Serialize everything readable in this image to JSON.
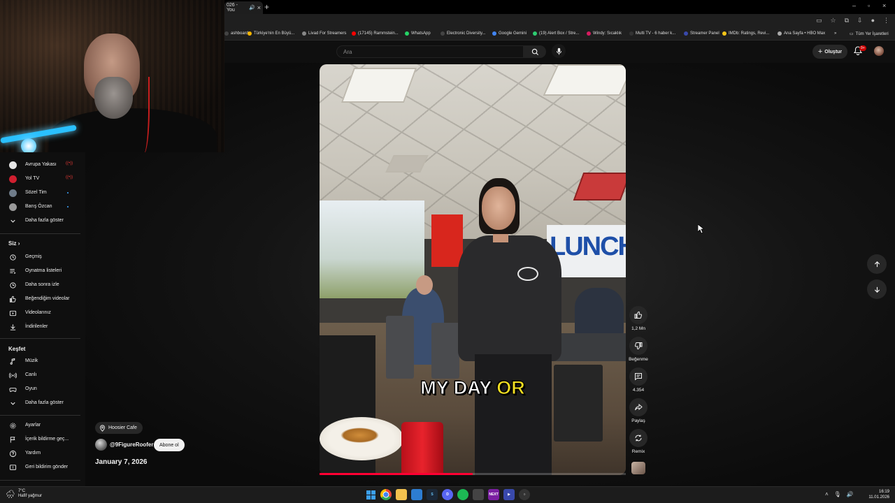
{
  "browser": {
    "tab_title": "026 - You",
    "bookmarks": [
      {
        "label": "ashboard",
        "color": "#444444"
      },
      {
        "label": "Türkiye'nin En Büyü...",
        "color": "#f4b400"
      },
      {
        "label": "Livad For Streamers",
        "color": "#888888"
      },
      {
        "label": "(17145) Rammstein...",
        "color": "#ff0000"
      },
      {
        "label": "WhatsApp",
        "color": "#25d366"
      },
      {
        "label": "Electronic Diversity...",
        "color": "#444444"
      },
      {
        "label": "Google Gemini",
        "color": "#4285f4"
      },
      {
        "label": "(19) Alert Box / Stre...",
        "color": "#2ecc71"
      },
      {
        "label": "Windy: Sıcaklık",
        "color": "#d81b60"
      },
      {
        "label": "Multi TV - 6 haber k...",
        "color": "#333333"
      },
      {
        "label": "Streamer Panel",
        "color": "#3949ab"
      },
      {
        "label": "IMDb: Ratings, Revi...",
        "color": "#f5c518"
      },
      {
        "label": "Ana Sayfa • HBO Max",
        "color": "#aaaaaa"
      }
    ],
    "more_bookmarks": "»",
    "all_bookmarks": "Tüm Yer İşaretleri"
  },
  "header": {
    "search_placeholder": "Ara",
    "create_label": "Oluştur",
    "notif_count": "9+"
  },
  "sidebar": {
    "subscriptions": [
      {
        "label": "Avrupa Yakası",
        "avatar_color": "#e6e6e6",
        "live": true
      },
      {
        "label": "Yol TV",
        "avatar_color": "#d01f2f",
        "live": true
      },
      {
        "label": "Sözel Tim",
        "avatar_color": "#6f7c8a",
        "live": false
      },
      {
        "label": "Barış Özcan",
        "avatar_color": "#9a9a9a",
        "live": false
      }
    ],
    "live_mark": "((•))",
    "show_more": "Daha fazla göster",
    "you_section": "Siz",
    "you_items": [
      {
        "icon": "history-icon",
        "label": "Geçmiş"
      },
      {
        "icon": "playlist-icon",
        "label": "Oynatma listeleri"
      },
      {
        "icon": "watch-later-icon",
        "label": "Daha sonra izle"
      },
      {
        "icon": "like-icon",
        "label": "Beğendiğim videolar"
      },
      {
        "icon": "your-videos-icon",
        "label": "Videolarınız"
      },
      {
        "icon": "download-icon",
        "label": "İndirilenler"
      }
    ],
    "explore_section": "Keşfet",
    "explore_items": [
      {
        "icon": "music-icon",
        "label": "Müzik"
      },
      {
        "icon": "live-icon",
        "label": "Canlı"
      },
      {
        "icon": "gaming-icon",
        "label": "Oyun"
      },
      {
        "icon": "chevron-down-icon",
        "label": "Daha fazla göster"
      }
    ],
    "footer_items": [
      {
        "icon": "settings-icon",
        "label": "Ayarlar"
      },
      {
        "icon": "flag-icon",
        "label": "İçerik bildirme geç..."
      },
      {
        "icon": "help-icon",
        "label": "Yardım"
      },
      {
        "icon": "feedback-icon",
        "label": "Geri bildirim gönder"
      }
    ]
  },
  "video": {
    "caption_white": "MY DAY ",
    "caption_yellow": "OR",
    "sign_text": "LUNCH",
    "progress": 0.5
  },
  "actions": {
    "likes": "1,2 Mn",
    "dislike": "Beğenme",
    "comments": "4.354",
    "share": "Paylaş",
    "remix": "Remix"
  },
  "info": {
    "location": "Hoosier Cafe",
    "channel": "@9FigureRoofer",
    "subscribe": "Abone ol",
    "date": "January 7, 2026"
  },
  "taskbar": {
    "temp": "7°C",
    "weather": "Hafif yağmur",
    "time": "16:19",
    "date": "11.01.2026"
  }
}
